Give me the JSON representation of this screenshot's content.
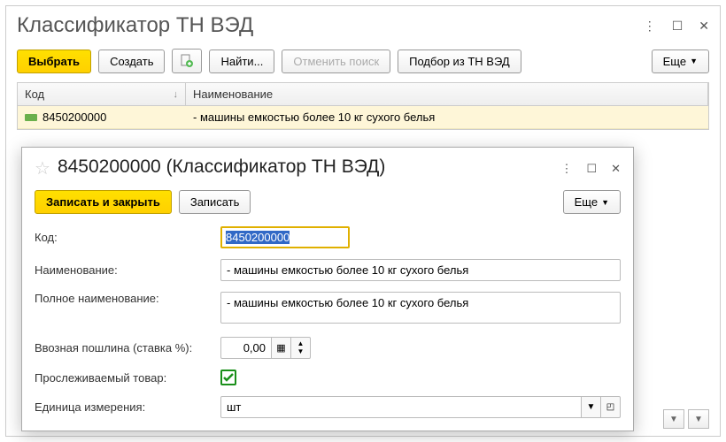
{
  "main": {
    "title": "Классификатор ТН ВЭД",
    "toolbar": {
      "select": "Выбрать",
      "create": "Создать",
      "find": "Найти...",
      "cancel_search": "Отменить поиск",
      "pick_from": "Подбор из ТН ВЭД",
      "more": "Еще"
    },
    "table": {
      "col_code": "Код",
      "col_name": "Наименование",
      "rows": [
        {
          "code": "8450200000",
          "name": "- машины емкостью более 10 кг сухого белья"
        }
      ]
    }
  },
  "dialog": {
    "title": "8450200000 (Классификатор ТН ВЭД)",
    "toolbar": {
      "save_close": "Записать и закрыть",
      "save": "Записать",
      "more": "Еще"
    },
    "form": {
      "code_label": "Код:",
      "code_value": "8450200000",
      "name_label": "Наименование:",
      "name_value": "- машины емкостью более 10 кг сухого белья",
      "fullname_label": "Полное наименование:",
      "fullname_value": "- машины емкостью более 10 кг сухого белья",
      "duty_label": "Ввозная пошлина (ставка %):",
      "duty_value": "0,00",
      "traceable_label": "Прослеживаемый товар:",
      "traceable_checked": true,
      "unit_label": "Единица измерения:",
      "unit_value": "шт"
    }
  }
}
